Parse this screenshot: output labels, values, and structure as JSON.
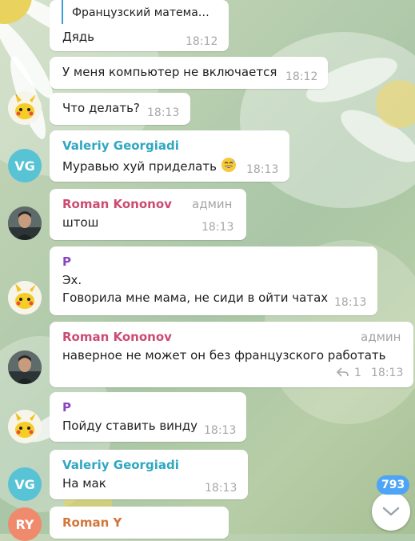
{
  "colors": {
    "name_green": "#2fa7c1",
    "name_red": "#cc4b73",
    "name_purple": "#8a45c5",
    "name_orange": "#d2763a",
    "avatar_vg": "#58c3d4",
    "avatar_ry": "#f08a6c",
    "accent_blue": "#4ea4f6"
  },
  "messages": [
    {
      "reply_preview": "Французский матема…",
      "text": "Дядь",
      "time": "18:12"
    },
    {
      "text": "У меня компьютер не включается",
      "time": "18:12"
    },
    {
      "avatar_icon": "pikachu-icon",
      "text": "Что делать?",
      "time": "18:13"
    },
    {
      "avatar_initials": "VG",
      "author": "Valeriy Georgiadi",
      "text": "Муравью хуй приделать",
      "emoji_icon": "grinning-sweat-emoji",
      "time": "18:13"
    },
    {
      "avatar_icon": "user-photo",
      "author": "Roman Kononov",
      "role": "админ",
      "text": "штош",
      "time": "18:13"
    },
    {
      "avatar_icon": "pikachu-icon",
      "author": "P",
      "line1": "Эх.",
      "line2": "Говорила мне мама, не сиди в ойти чатах",
      "time": "18:13"
    },
    {
      "avatar_icon": "user-photo",
      "author": "Roman Kononov",
      "role": "админ",
      "text": "наверное не может он без французского работать",
      "reply_count": "1",
      "time": "18:13"
    },
    {
      "avatar_icon": "pikachu-icon",
      "author": "P",
      "text": "Пойду ставить винду",
      "time": "18:13"
    },
    {
      "avatar_initials": "VG",
      "author": "Valeriy Georgiadi",
      "text": "На мак",
      "time": "18:13"
    },
    {
      "avatar_initials": "RY",
      "author": "Roman Y"
    }
  ],
  "unread_count": "793",
  "scroll_icon": "chevron-down-icon"
}
